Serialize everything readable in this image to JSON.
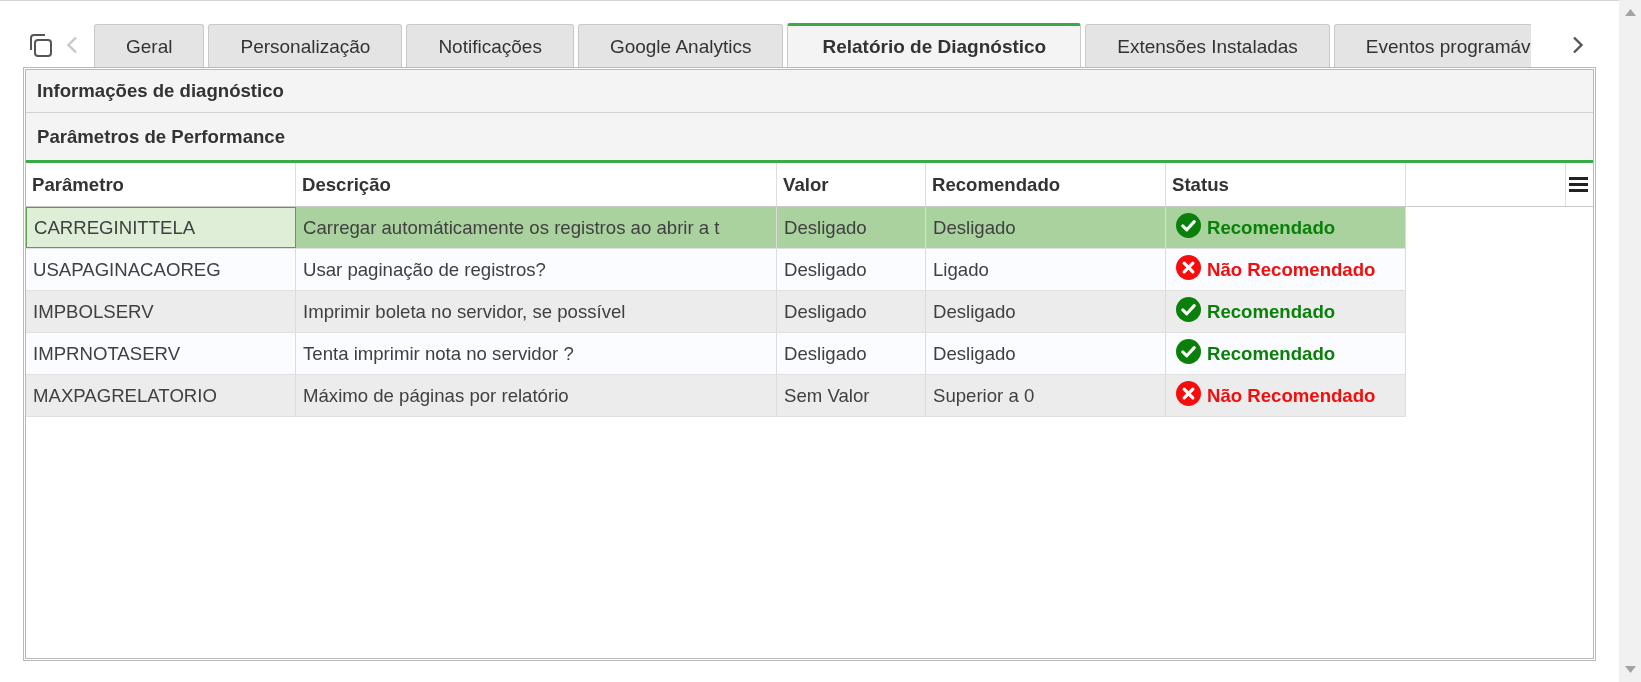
{
  "tab_scroll": {
    "previous": {
      "disabled": true
    },
    "next": {
      "disabled": false
    }
  },
  "tabs": [
    {
      "label": "Geral",
      "selected": false
    },
    {
      "label": "Personalização",
      "selected": false
    },
    {
      "label": "Notificações",
      "selected": false
    },
    {
      "label": "Google Analytics",
      "selected": false
    },
    {
      "label": "Relatório de Diagnóstico",
      "selected": true
    },
    {
      "label": "Extensões Instaladas",
      "selected": false
    },
    {
      "label": "Eventos programáv",
      "selected": false
    }
  ],
  "sections": [
    {
      "title": "Informações de diagnóstico",
      "expanded": false
    },
    {
      "title": "Parâmetros de Performance",
      "expanded": true,
      "table": {
        "columns": [
          "Parâmetro",
          "Descrição",
          "Valor",
          "Recomendado",
          "Status"
        ],
        "rows": [
          {
            "selected": true,
            "cells": [
              {
                "text": "CARREGINITTELA",
                "focused": true
              },
              {
                "text": "Carregar automáticamente os registros ao abrir a t",
                "focused": false
              },
              {
                "text": "Desligado",
                "focused": false
              },
              {
                "text": "Desligado",
                "focused": false
              }
            ],
            "status": {
              "kind": "recommended",
              "label": "Recomendado"
            }
          },
          {
            "selected": false,
            "cells": [
              {
                "text": "USAPAGINACAOREG",
                "focused": false
              },
              {
                "text": "Usar paginação de registros?",
                "focused": false
              },
              {
                "text": "Desligado",
                "focused": false
              },
              {
                "text": "Ligado",
                "focused": false
              }
            ],
            "status": {
              "kind": "not_recommended",
              "label": "Não Recomendado"
            }
          },
          {
            "selected": false,
            "cells": [
              {
                "text": "IMPBOLSERV",
                "focused": false
              },
              {
                "text": "Imprimir boleta no servidor, se possível",
                "focused": false
              },
              {
                "text": "Desligado",
                "focused": false
              },
              {
                "text": "Desligado",
                "focused": false
              }
            ],
            "status": {
              "kind": "recommended",
              "label": "Recomendado"
            }
          },
          {
            "selected": false,
            "cells": [
              {
                "text": "IMPRNOTASERV",
                "focused": false
              },
              {
                "text": "Tenta imprimir nota no servidor ?",
                "focused": false
              },
              {
                "text": "Desligado",
                "focused": false
              },
              {
                "text": "Desligado",
                "focused": false
              }
            ],
            "status": {
              "kind": "recommended",
              "label": "Recomendado"
            }
          },
          {
            "selected": false,
            "cells": [
              {
                "text": "MAXPAGRELATORIO",
                "focused": false
              },
              {
                "text": "Máximo de páginas por relatório",
                "focused": false
              },
              {
                "text": "Sem Valor",
                "focused": false
              },
              {
                "text": "Superior a 0",
                "focused": false
              }
            ],
            "status": {
              "kind": "not_recommended",
              "label": "Não Recomendado"
            }
          }
        ]
      }
    }
  ]
}
